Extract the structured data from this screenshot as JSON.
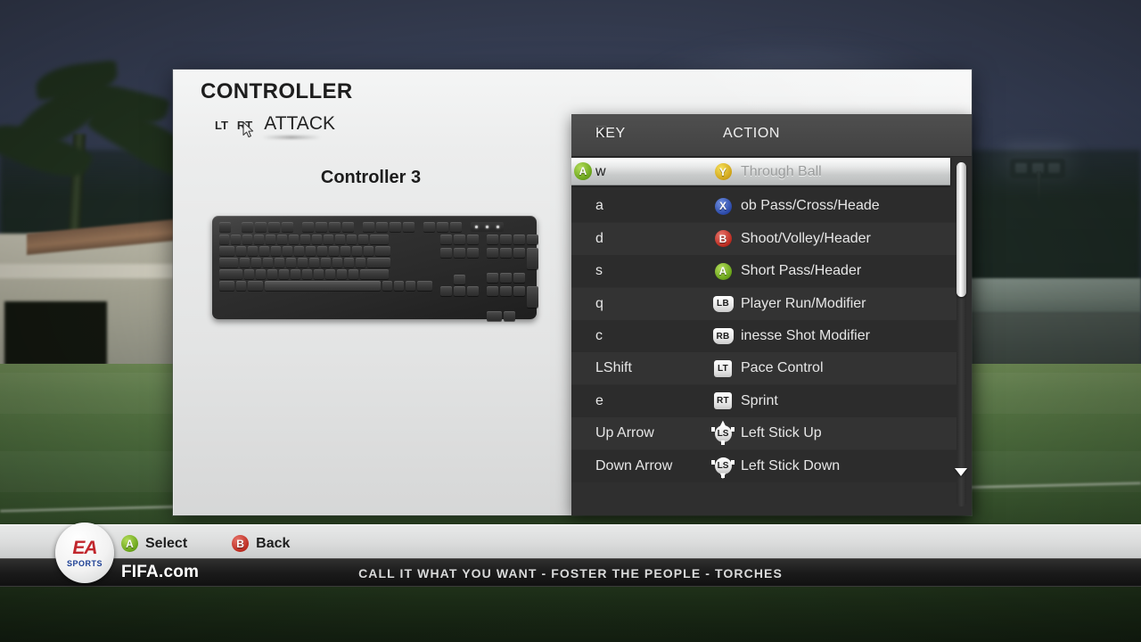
{
  "panel": {
    "title": "CONTROLLER",
    "controller_label": "Controller 3",
    "keyboard_icon": "keyboard-graphic"
  },
  "tabs": {
    "left_trigger": "LT",
    "right_trigger": "RT",
    "active": "ATTACK"
  },
  "table": {
    "headers": {
      "key": "KEY",
      "action": "ACTION"
    },
    "selected_index": 0,
    "select_badge": "A",
    "rows": [
      {
        "key": "w",
        "badge": "Y",
        "badge_type": "face",
        "action": "Through Ball"
      },
      {
        "key": "a",
        "badge": "X",
        "badge_type": "face",
        "action": "ob Pass/Cross/Heade"
      },
      {
        "key": "d",
        "badge": "B",
        "badge_type": "face",
        "action": "Shoot/Volley/Header"
      },
      {
        "key": "s",
        "badge": "A",
        "badge_type": "face",
        "action": "Short Pass/Header"
      },
      {
        "key": "q",
        "badge": "LB",
        "badge_type": "shoulder",
        "action": "Player Run/Modifier"
      },
      {
        "key": "c",
        "badge": "RB",
        "badge_type": "shoulder",
        "action": "inesse Shot Modifier"
      },
      {
        "key": "LShift",
        "badge": "LT",
        "badge_type": "trigger",
        "action": "Pace Control"
      },
      {
        "key": "e",
        "badge": "RT",
        "badge_type": "trigger",
        "action": "Sprint"
      },
      {
        "key": "Up Arrow",
        "badge": "LS",
        "badge_type": "stick-up",
        "action": "Left Stick Up"
      },
      {
        "key": "Down Arrow",
        "badge": "LS",
        "badge_type": "stick-down",
        "action": "Left Stick Down"
      }
    ]
  },
  "scrollbar": {
    "thumb_position_pct": 0,
    "thumb_size_pct": 39,
    "down_arrow_icon": "chevron-down-icon"
  },
  "footer": {
    "hints": [
      {
        "badge": "A",
        "badge_color": "#79a828",
        "label": "Select"
      },
      {
        "badge": "B",
        "badge_color": "#bc2b20",
        "label": "Back"
      }
    ],
    "fifa_com": "FIFA.com",
    "ticker": "CALL IT WHAT YOU WANT - FOSTER THE PEOPLE - TORCHES",
    "logo": {
      "brand": "EA",
      "sub": "SPORTS"
    }
  },
  "colors": {
    "panel_bg": "#eceded",
    "table_bg": "#2f2f2f",
    "table_head": "#474747",
    "accent_green": "#79a828",
    "accent_red": "#bc2b20",
    "accent_blue": "#2b49a8",
    "accent_yellow": "#cfa318"
  }
}
